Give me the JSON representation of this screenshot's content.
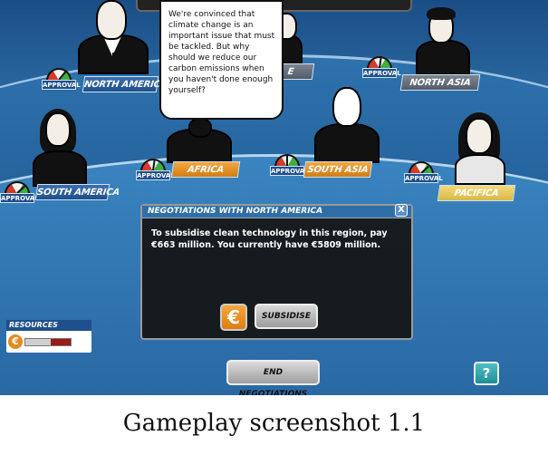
{
  "window": {
    "speech_text": "We're convinced that climate change is an important issue that must be tackled. But why should we reduce our carbon emissions when you haven't done enough yourself?"
  },
  "delegates": [
    {
      "id": "north-america",
      "label": "NORTH AMERICA",
      "approval_level": 0.75
    },
    {
      "id": "europe",
      "label": "E",
      "approval_level": 0.5
    },
    {
      "id": "north-asia",
      "label": "NORTH ASIA",
      "approval_level": 0.55
    },
    {
      "id": "south-america",
      "label": "SOUTH AMERICA",
      "approval_level": 0.8
    },
    {
      "id": "africa",
      "label": "AFRICA",
      "approval_level": 0.55
    },
    {
      "id": "south-asia",
      "label": "SOUTH ASIA",
      "approval_level": 0.5
    },
    {
      "id": "pacifica",
      "label": "PACIFICA",
      "approval_level": 0.8
    }
  ],
  "approval_label": "APPROVAL",
  "dialog": {
    "title": "NEGOTIATIONS WITH NORTH AMERICA",
    "close": "X",
    "body": "To subsidise clean technology in this region, pay €663 million. You currently have €5809 million.",
    "euro_symbol": "€",
    "subsidise_label": "SUBSIDISE"
  },
  "resources": {
    "label": "RESOURCES",
    "icon": "€",
    "level": 0.45
  },
  "buttons": {
    "end_negotiations": "END NEGOTIATIONS",
    "help": "?"
  },
  "caption": "Gameplay screenshot 1.1",
  "colors": {
    "sea": "#2b6da8",
    "plate_blue": "#1f4f8c",
    "plate_orange": "#d27c12",
    "plate_yellow": "#d9b848",
    "highlight_region": "#f39b2b"
  }
}
